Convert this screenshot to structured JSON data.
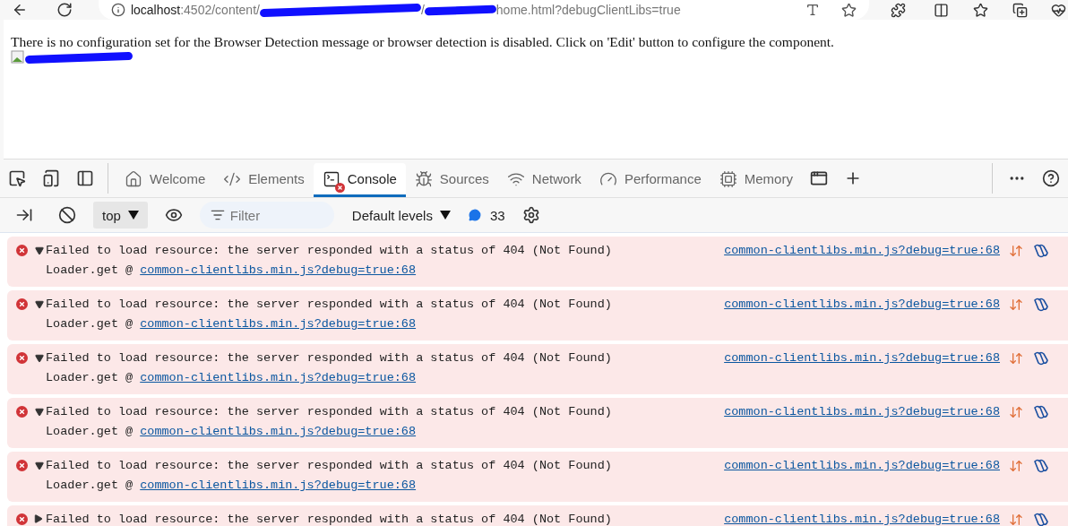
{
  "address_bar": {
    "url_parts": [
      {
        "kind": "host",
        "text": "localhost"
      },
      {
        "kind": "path",
        "text": ":4502/content/"
      },
      {
        "kind": "redaction"
      },
      {
        "kind": "path",
        "text": "/"
      },
      {
        "kind": "redaction"
      },
      {
        "kind": "path",
        "text": "home.html?debugClientLibs=true"
      }
    ]
  },
  "page": {
    "message": "There is no configuration set for the Browser Detection message or browser detection is disabled. Click on 'Edit' button to configure the component."
  },
  "devtools": {
    "tabs": [
      {
        "kind": "welcome",
        "label": "Welcome",
        "selected": false,
        "error_badge": false
      },
      {
        "kind": "elements",
        "label": "Elements",
        "selected": false,
        "error_badge": false
      },
      {
        "kind": "console",
        "label": "Console",
        "selected": true,
        "error_badge": true
      },
      {
        "kind": "sources",
        "label": "Sources",
        "selected": false,
        "error_badge": false
      },
      {
        "kind": "network",
        "label": "Network",
        "selected": false,
        "error_badge": false
      },
      {
        "kind": "performance",
        "label": "Performance",
        "selected": false,
        "error_badge": false
      },
      {
        "kind": "memory",
        "label": "Memory",
        "selected": false,
        "error_badge": false
      }
    ],
    "console_toolbar": {
      "context": "top",
      "filter_placeholder": "Filter",
      "levels": "Default levels",
      "message_count": "33"
    },
    "messages": [
      {
        "kind": "error",
        "expanded": true,
        "text": "Failed to load resource: the server responded with a status of 404 (Not Found)",
        "stack_function": "Loader.get @",
        "stack_link": "common-clientlibs.min.js?debug=true:68",
        "source": "common-clientlibs.min.js?debug=true:68"
      },
      {
        "kind": "error",
        "expanded": true,
        "text": "Failed to load resource: the server responded with a status of 404 (Not Found)",
        "stack_function": "Loader.get @",
        "stack_link": "common-clientlibs.min.js?debug=true:68",
        "source": "common-clientlibs.min.js?debug=true:68"
      },
      {
        "kind": "error",
        "expanded": true,
        "text": "Failed to load resource: the server responded with a status of 404 (Not Found)",
        "stack_function": "Loader.get @",
        "stack_link": "common-clientlibs.min.js?debug=true:68",
        "source": "common-clientlibs.min.js?debug=true:68"
      },
      {
        "kind": "error",
        "expanded": true,
        "text": "Failed to load resource: the server responded with a status of 404 (Not Found)",
        "stack_function": "Loader.get @",
        "stack_link": "common-clientlibs.min.js?debug=true:68",
        "source": "common-clientlibs.min.js?debug=true:68"
      },
      {
        "kind": "error",
        "expanded": true,
        "text": "Failed to load resource: the server responded with a status of 404 (Not Found)",
        "stack_function": "Loader.get @",
        "stack_link": "common-clientlibs.min.js?debug=true:68",
        "source": "common-clientlibs.min.js?debug=true:68"
      },
      {
        "kind": "error",
        "expanded": false,
        "text": "Failed to load resource: the server responded with a status of 404 (Not Found)",
        "source": "common-clientlibs.min.js?debug=true:68"
      }
    ]
  }
}
